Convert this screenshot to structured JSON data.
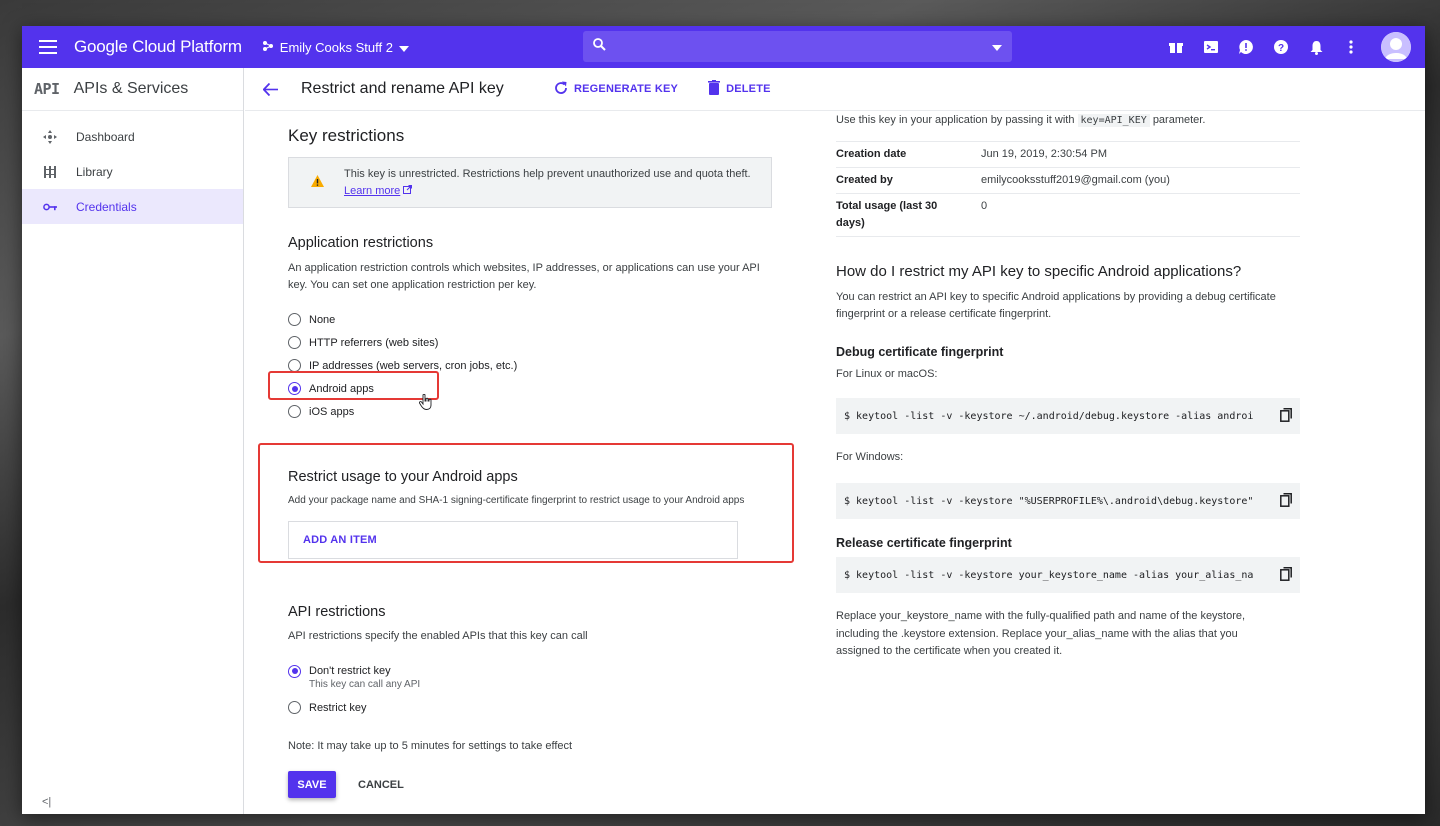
{
  "topbar": {
    "brand": "Google Cloud Platform",
    "project": "Emily Cooks Stuff 2",
    "search_placeholder": "",
    "icons": [
      "gift-icon",
      "cloud-shell-icon",
      "feedback-icon",
      "help-icon",
      "notifications-icon",
      "more-vert-icon",
      "avatar"
    ]
  },
  "sidebar": {
    "logo": "API",
    "title": "APIs & Services",
    "items": [
      {
        "label": "Dashboard",
        "icon": "dashboard-icon"
      },
      {
        "label": "Library",
        "icon": "library-icon"
      },
      {
        "label": "Credentials",
        "icon": "key-icon",
        "active": true
      }
    ],
    "collapse": "<|"
  },
  "header": {
    "title": "Restrict and rename API key",
    "regenerate": "REGENERATE KEY",
    "delete": "DELETE"
  },
  "key_restrictions": {
    "heading": "Key restrictions",
    "warning_text": "This key is unrestricted. Restrictions help prevent unauthorized use and quota theft.",
    "learn_more": "Learn more"
  },
  "app_restrictions": {
    "heading": "Application restrictions",
    "desc": "An application restriction controls which websites, IP addresses, or applications can use your API key. You can set one application restriction per key.",
    "options": [
      {
        "label": "None",
        "selected": false
      },
      {
        "label": "HTTP referrers (web sites)",
        "selected": false
      },
      {
        "label": "IP addresses (web servers, cron jobs, etc.)",
        "selected": false
      },
      {
        "label": "Android apps",
        "selected": true
      },
      {
        "label": "iOS apps",
        "selected": false
      }
    ]
  },
  "android": {
    "heading": "Restrict usage to your Android apps",
    "desc": "Add your package name and SHA-1 signing-certificate fingerprint to restrict usage to your Android apps",
    "add_item": "ADD AN ITEM"
  },
  "api_restrictions": {
    "heading": "API restrictions",
    "desc": "API restrictions specify the enabled APIs that this key can call",
    "options": [
      {
        "label": "Don't restrict key",
        "sub": "This key can call any API",
        "selected": true
      },
      {
        "label": "Restrict key",
        "sub": "",
        "selected": false
      }
    ],
    "note": "Note: It may take up to 5 minutes for settings to take effect"
  },
  "actions": {
    "save": "SAVE",
    "cancel": "CANCEL"
  },
  "right": {
    "usage_pre": "Use this key in your application by passing it with",
    "usage_code": "key=API_KEY",
    "usage_post": "parameter.",
    "info": [
      {
        "key": "Creation date",
        "value": "Jun 19, 2019, 2:30:54 PM"
      },
      {
        "key": "Created by",
        "value": "emilycooksstuff2019@gmail.com (you)"
      },
      {
        "key": "Total usage (last 30 days)",
        "value": "0"
      }
    ],
    "how_heading": "How do I restrict my API key to specific Android applications?",
    "how_desc": "You can restrict an API key to specific Android applications by providing a debug certificate fingerprint or a release certificate fingerprint.",
    "debug_heading": "Debug certificate fingerprint",
    "linux_label": "For Linux or macOS:",
    "linux_cmd": "$ keytool -list -v -keystore ~/.android/debug.keystore -alias androi",
    "windows_label": "For Windows:",
    "windows_cmd": "$ keytool -list -v -keystore \"%USERPROFILE%\\.android\\debug.keystore\"",
    "release_heading": "Release certificate fingerprint",
    "release_cmd": "$ keytool -list -v -keystore your_keystore_name -alias your_alias_na",
    "release_desc": "Replace your_keystore_name with the fully-qualified path and name of the keystore, including the .keystore extension. Replace your_alias_name with the alias that you assigned to the certificate when you created it."
  },
  "colors": {
    "brand": "#5333ed",
    "highlight": "#e53935"
  }
}
